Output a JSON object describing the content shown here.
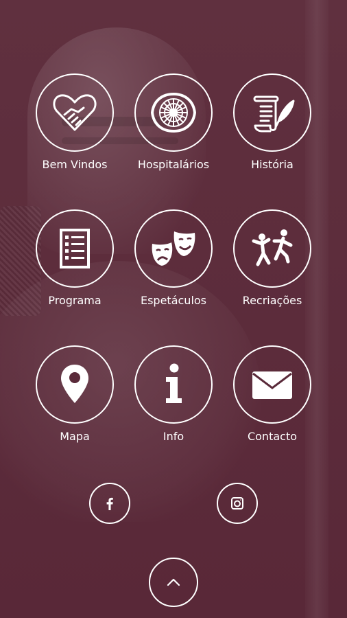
{
  "menu": {
    "items": [
      {
        "label": "Bem Vindos",
        "icon": "heart-handshake-icon"
      },
      {
        "label": "Hospitalários",
        "icon": "rose-window-icon"
      },
      {
        "label": "História",
        "icon": "scroll-quill-icon"
      },
      {
        "label": "Programa",
        "icon": "program-list-icon"
      },
      {
        "label": "Espetáculos",
        "icon": "theater-masks-icon"
      },
      {
        "label": "Recriações",
        "icon": "dancers-icon"
      },
      {
        "label": "Mapa",
        "icon": "map-pin-icon"
      },
      {
        "label": "Info",
        "icon": "info-icon"
      },
      {
        "label": "Contacto",
        "icon": "envelope-icon"
      }
    ]
  },
  "social": {
    "facebook_icon": "facebook-icon",
    "instagram_icon": "instagram-icon"
  },
  "footer": {
    "scroll_up_icon": "chevron-up-icon"
  },
  "theme": {
    "background": "#5a2a3a",
    "foreground": "#ffffff"
  }
}
